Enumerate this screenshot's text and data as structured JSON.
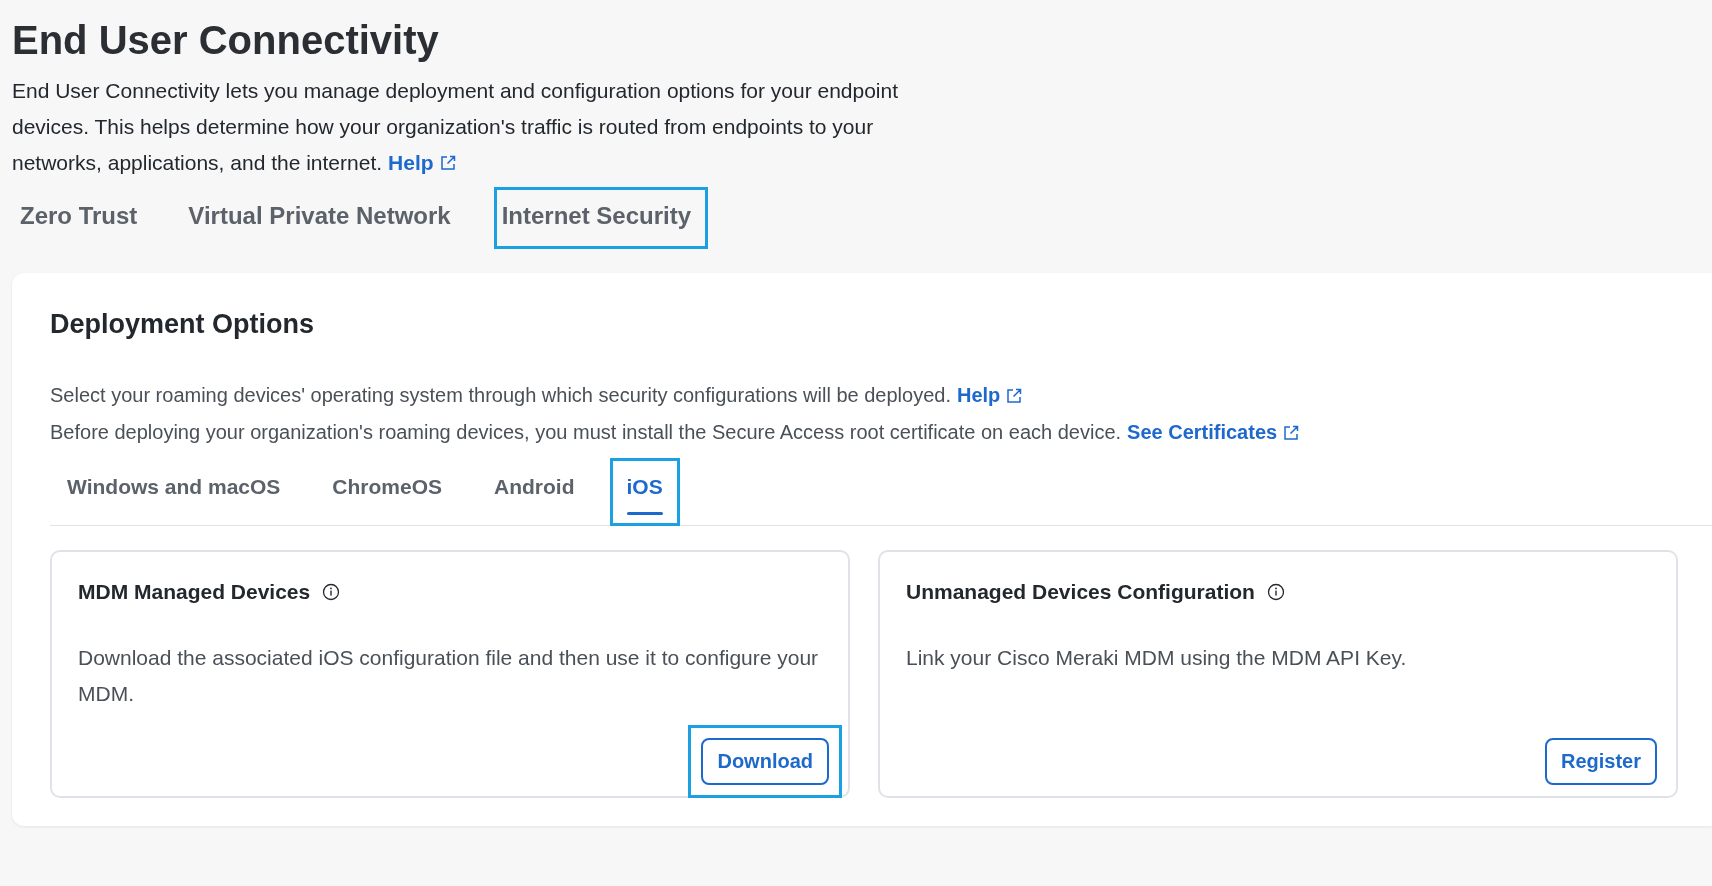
{
  "page": {
    "title": "End User Connectivity",
    "description": "End User Connectivity lets you manage deployment and configuration options for your endpoint devices. This helps determine how your organization's traffic is routed from endpoints to your networks, applications, and the internet.",
    "help_link": "Help"
  },
  "top_tabs": [
    {
      "label": "Zero Trust",
      "highlighted": false
    },
    {
      "label": "Virtual Private Network",
      "highlighted": false
    },
    {
      "label": "Internet Security",
      "highlighted": true
    }
  ],
  "deployment": {
    "title": "Deployment Options",
    "lines": [
      {
        "text": "Select your roaming devices' operating system through which security configurations will be deployed.",
        "link": "Help"
      },
      {
        "text": "Before deploying your organization's roaming devices, you must install the Secure Access root certificate on each device.",
        "link": "See Certificates"
      }
    ],
    "os_tabs": [
      {
        "label": "Windows and macOS",
        "selected": false,
        "highlighted": false
      },
      {
        "label": "ChromeOS",
        "selected": false,
        "highlighted": false
      },
      {
        "label": "Android",
        "selected": false,
        "highlighted": false
      },
      {
        "label": "iOS",
        "selected": true,
        "highlighted": true
      }
    ],
    "cards": [
      {
        "title": "MDM Managed Devices",
        "text": "Download the associated iOS configuration file and then use it to configure your MDM.",
        "button": "Download",
        "highlighted": true
      },
      {
        "title": "Unmanaged Devices Configuration",
        "text": "Link your Cisco Meraki MDM using the MDM API Key.",
        "button": "Register",
        "highlighted": false
      }
    ]
  }
}
